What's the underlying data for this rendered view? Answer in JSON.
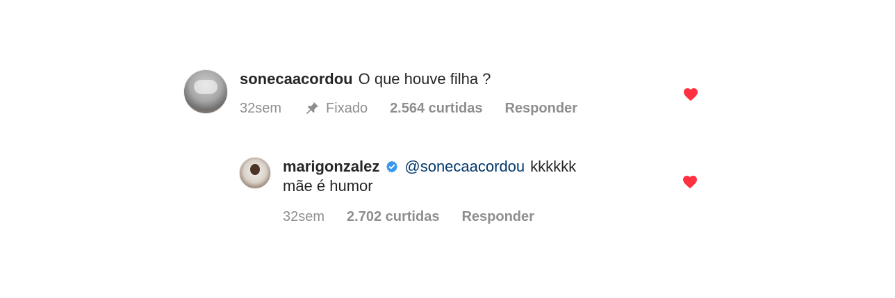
{
  "comment": {
    "username": "sonecaacordou",
    "text": "O que houve filha ?",
    "time": "32sem",
    "pinned_label": "Fixado",
    "likes": "2.564 curtidas",
    "reply_label": "Responder"
  },
  "reply": {
    "username": "marigonzalez",
    "mention": "@sonecaacordou",
    "text_line1": "kkkkkk",
    "text_line2": "mãe é humor",
    "time": "32sem",
    "likes": "2.702 curtidas",
    "reply_label": "Responder"
  },
  "colors": {
    "heart": "#ff3040",
    "verified": "#3897f0",
    "mention": "#00376b",
    "meta": "#8e8e8e",
    "text": "#262626"
  },
  "icons": {
    "pinned": "pin-icon",
    "verified": "verified-icon",
    "like": "heart-icon"
  }
}
